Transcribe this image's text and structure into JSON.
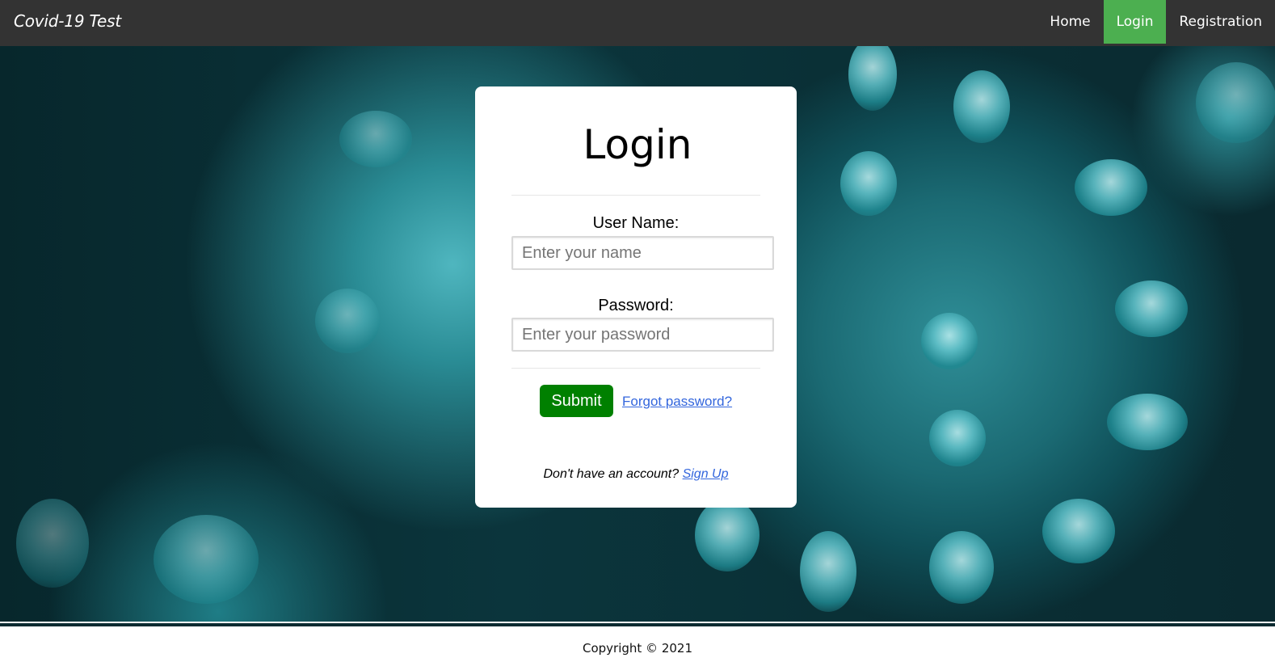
{
  "navbar": {
    "brand": "Covid-19 Test",
    "links": [
      {
        "label": "Home",
        "active": false
      },
      {
        "label": "Login",
        "active": true
      },
      {
        "label": "Registration",
        "active": false
      }
    ],
    "background_color": "#333333",
    "active_color": "#4caf50"
  },
  "hero": {
    "background_image": "coronavirus-illustration"
  },
  "login_card": {
    "title": "Login",
    "username": {
      "label": "User Name:",
      "value": "",
      "placeholder": "Enter your name"
    },
    "password": {
      "label": "Password:",
      "value": "",
      "placeholder": "Enter your password"
    },
    "submit_label": "Submit",
    "submit_color": "#008000",
    "forgot_label": "Forgot password?",
    "signup_prompt": "Don't have an account?",
    "signup_label": "Sign Up",
    "link_color": "#3366dd"
  },
  "footer": {
    "copyright": "Copyright © 2021"
  }
}
